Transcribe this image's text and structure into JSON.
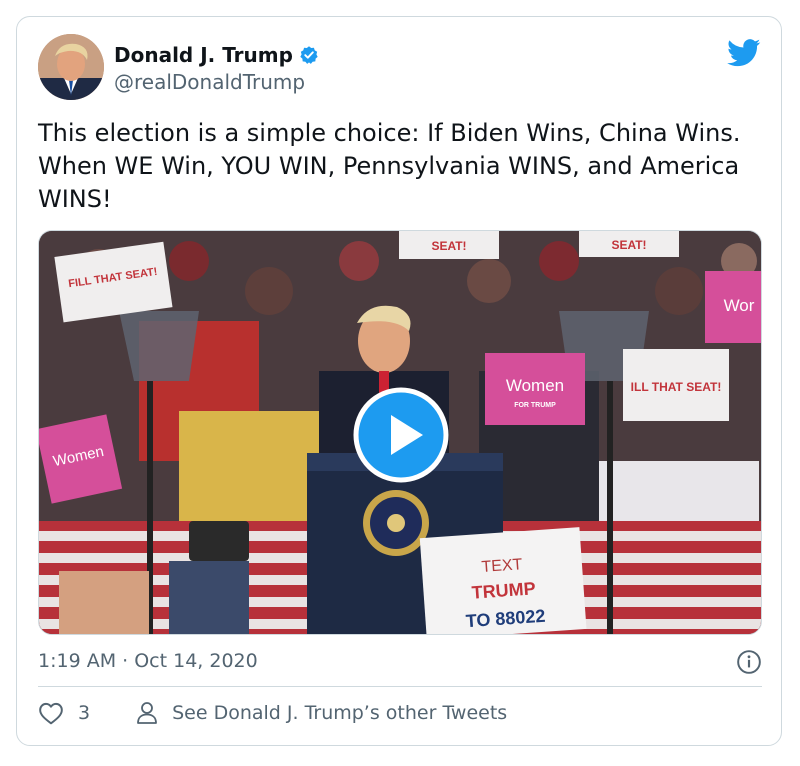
{
  "tweet": {
    "author_name": "Donald J. Trump",
    "author_handle": "@realDonaldTrump",
    "text": "This election is a simple choice: If Biden Wins, China Wins. When WE Win, YOU WIN, Pennsylvania WINS, and America WINS!",
    "timestamp": "1:19 AM · Oct 14, 2020",
    "like_count": "3",
    "other_tweets_label": "See Donald J. Trump’s other Tweets"
  },
  "media": {
    "type": "video",
    "signs": {
      "fill_that_seat_left": "FILL THAT SEAT!",
      "fill_that_seat_right": "ILL THAT SEAT!",
      "women_left": "Women",
      "women_center": "Women",
      "women_right": "Wor",
      "for_trump": "FOR TRUMP",
      "seat_top_left": "SEAT!",
      "seat_top_right": "SEAT!",
      "text_trump_line1": "TEXT",
      "text_trump_line2": "TRUMP",
      "text_trump_line3": "TO 88022"
    }
  },
  "icons": {
    "verified": "verified-badge-icon",
    "platform": "twitter-bird-icon",
    "play": "play-icon",
    "info": "info-icon",
    "like": "heart-icon",
    "profile": "person-icon"
  },
  "colors": {
    "brand_blue": "#1d9bf0",
    "secondary_text": "#536471",
    "border": "#cfd9de"
  }
}
